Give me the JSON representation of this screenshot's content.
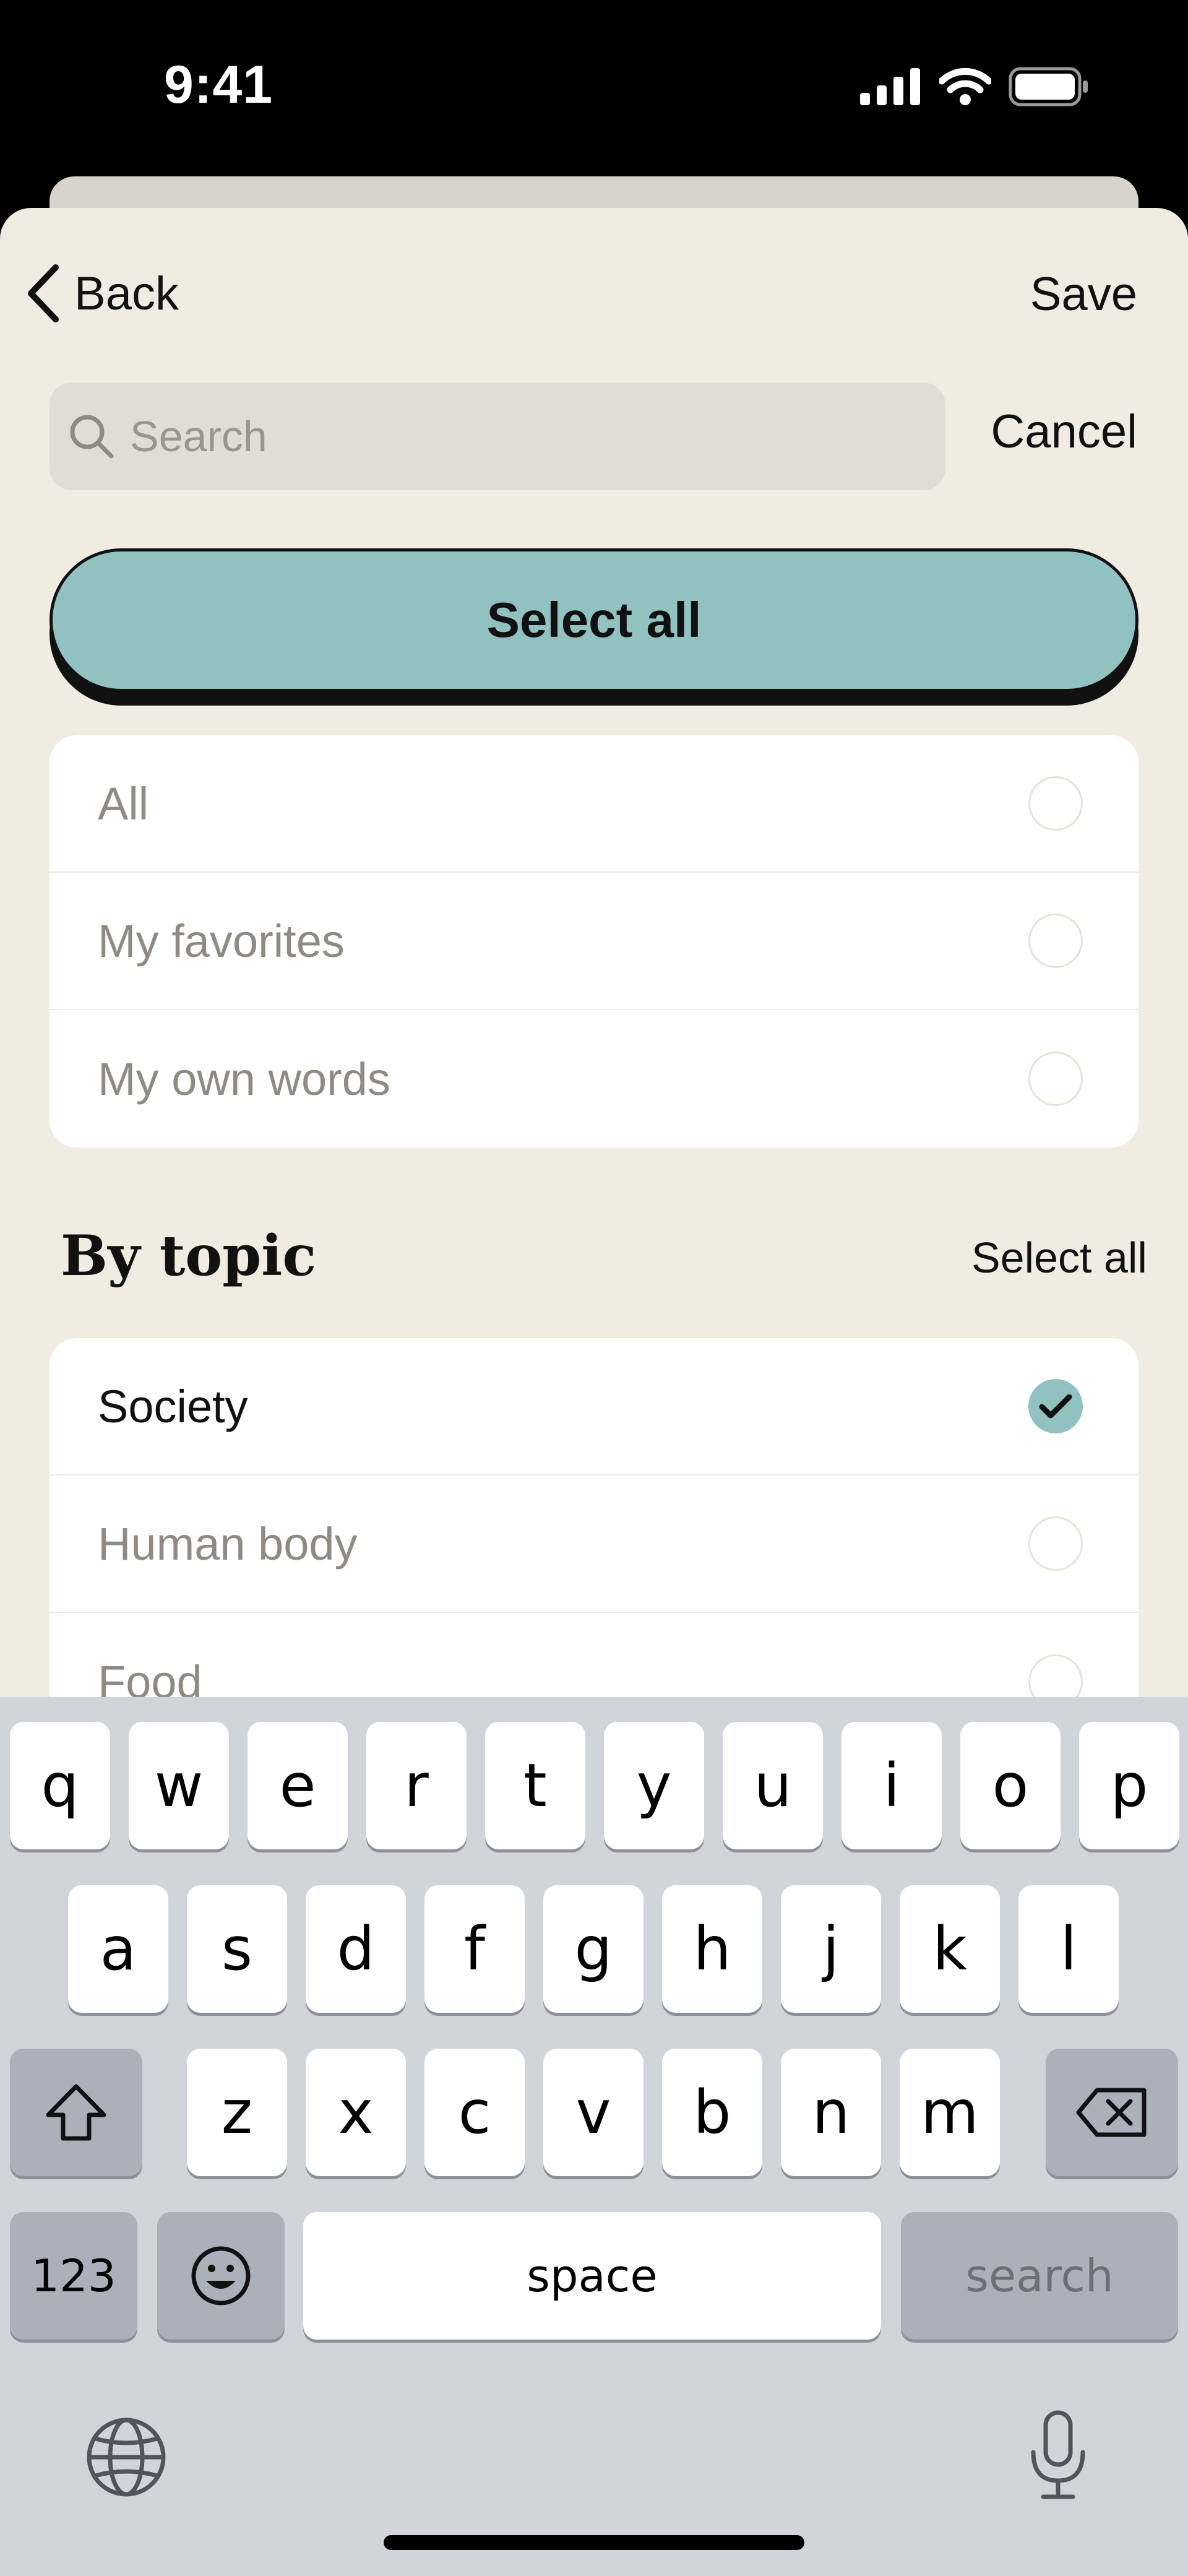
{
  "status_bar": {
    "time": "9:41"
  },
  "nav": {
    "back_label": "Back",
    "save_label": "Save"
  },
  "search": {
    "placeholder": "Search",
    "value": "",
    "cancel_label": "Cancel"
  },
  "select_all_button": "Select all",
  "filters": [
    {
      "label": "All",
      "checked": false
    },
    {
      "label": "My favorites",
      "checked": false
    },
    {
      "label": "My own words",
      "checked": false
    }
  ],
  "by_topic": {
    "title": "By topic",
    "select_all_label": "Select all",
    "items": [
      {
        "label": "Society",
        "checked": true
      },
      {
        "label": "Human body",
        "checked": false
      },
      {
        "label": "Food",
        "checked": false
      }
    ]
  },
  "keyboard": {
    "row1": [
      "q",
      "w",
      "e",
      "r",
      "t",
      "y",
      "u",
      "i",
      "o",
      "p"
    ],
    "row2": [
      "a",
      "s",
      "d",
      "f",
      "g",
      "h",
      "j",
      "k",
      "l"
    ],
    "row3": [
      "z",
      "x",
      "c",
      "v",
      "b",
      "n",
      "m"
    ],
    "numbers_key": "123",
    "space_key": "space",
    "search_key": "search"
  },
  "colors": {
    "accent": "#92c1c2",
    "background": "#f0ece2",
    "keyboard": "#d1d4db"
  }
}
